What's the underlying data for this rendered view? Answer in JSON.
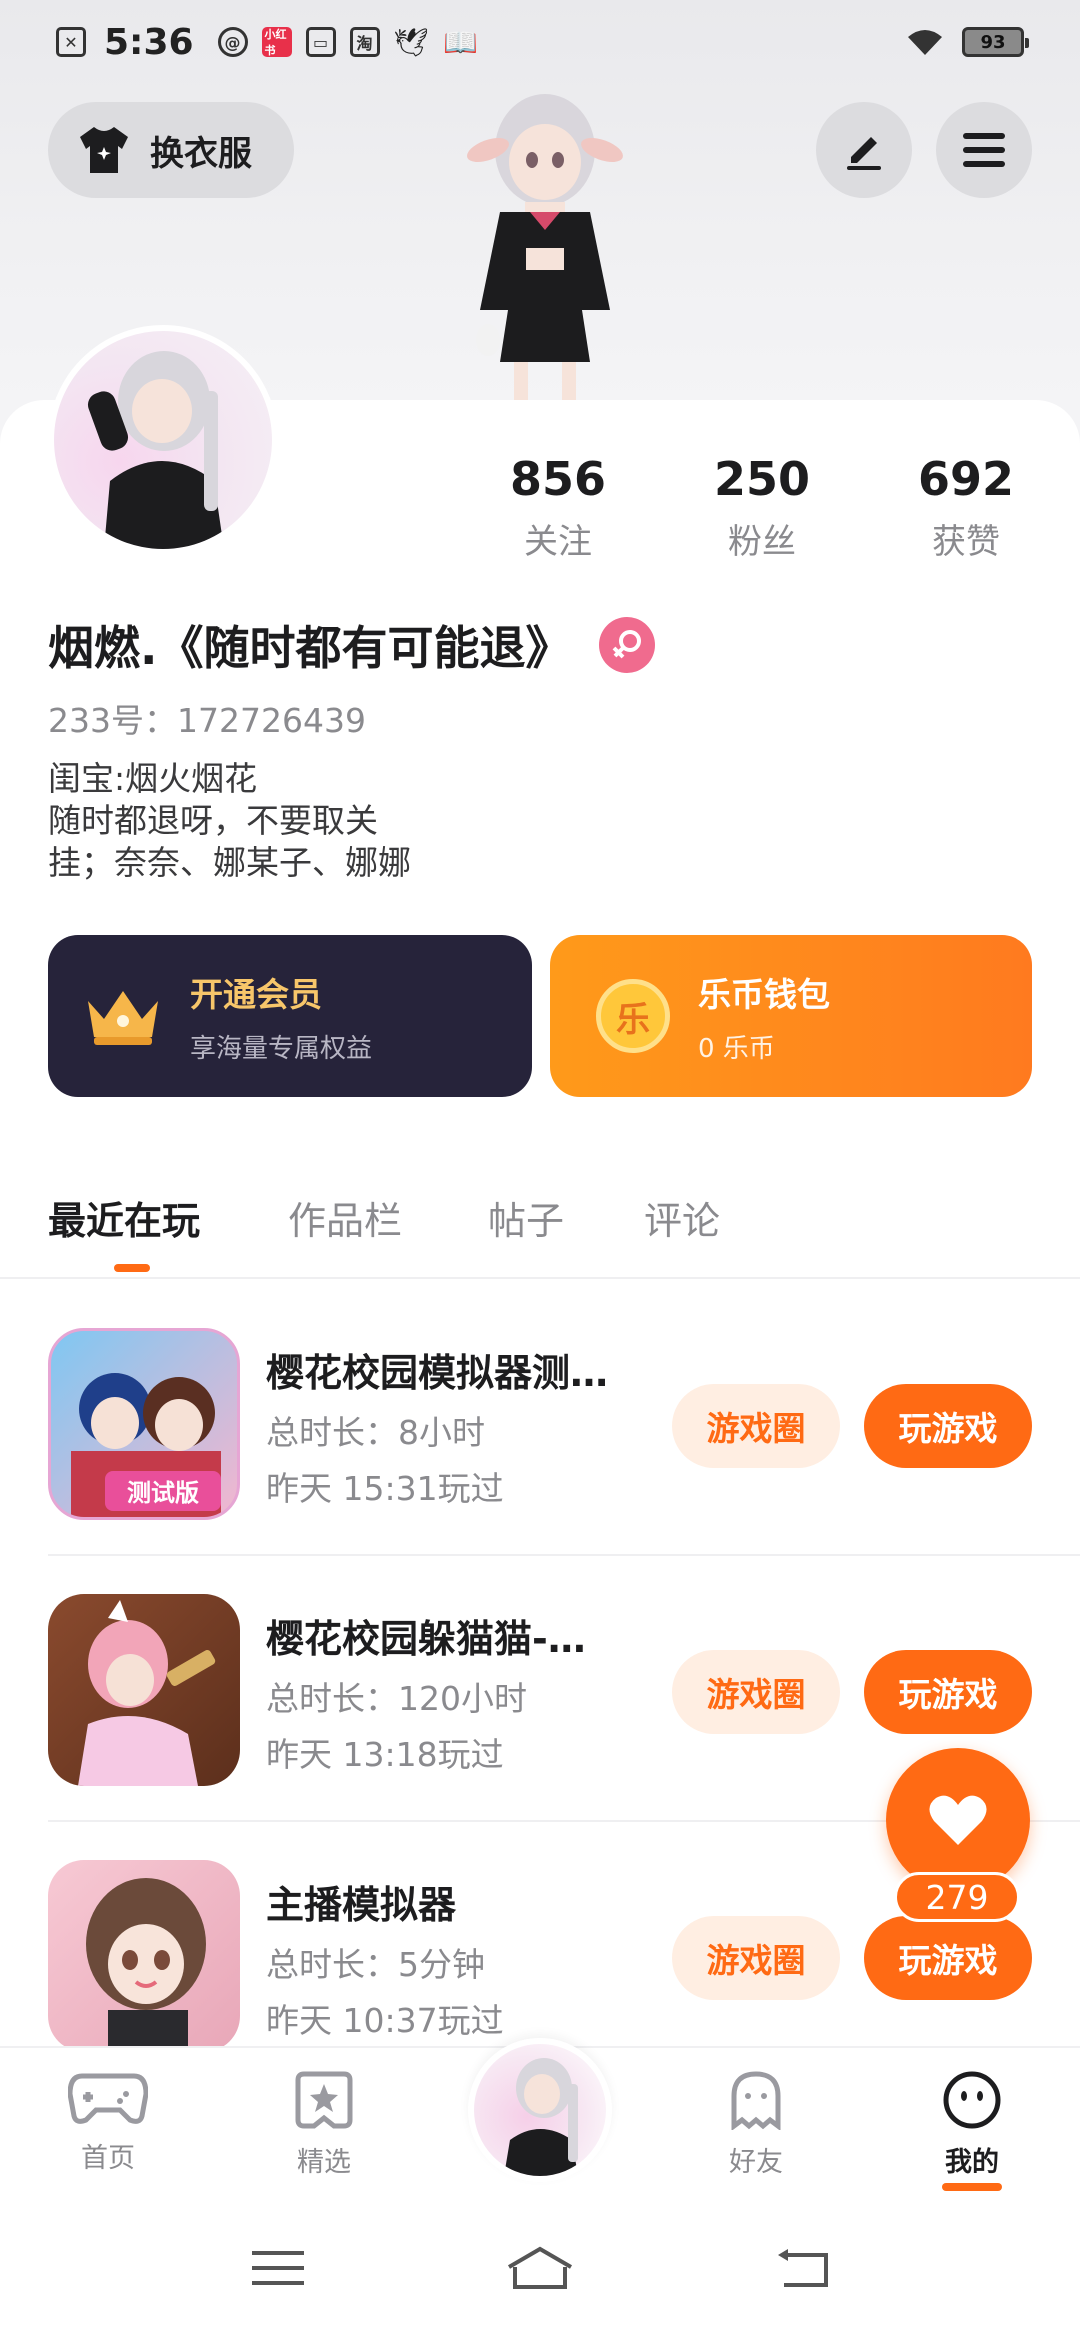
{
  "status_bar": {
    "time": "5:36",
    "icons": [
      "sim-x-icon",
      "chat-icon",
      "xiaohongshu-icon",
      "card-icon",
      "taobao-icon",
      "bird-icon",
      "book-icon"
    ],
    "xiaohongshu_text": "小红书",
    "taobao_text": "淘",
    "battery": "93"
  },
  "header": {
    "wardrobe_label": "换衣服",
    "edit_icon": "pencil-icon",
    "menu_icon": "hamburger-icon"
  },
  "profile": {
    "stats": [
      {
        "value": "856",
        "label": "关注"
      },
      {
        "value": "250",
        "label": "粉丝"
      },
      {
        "value": "692",
        "label": "获赞"
      }
    ],
    "nickname": "烟燃.《随时都有可能退》",
    "gender": "female-icon",
    "user_id": "233号：172726439",
    "bio": [
      "闺宝:烟火烟花",
      "随时都退呀，不要取关",
      "挂；奈奈、娜某子、娜娜"
    ]
  },
  "cards": {
    "vip": {
      "title": "开通会员",
      "subtitle": "享海量专属权益"
    },
    "wallet": {
      "title": "乐币钱包",
      "subtitle": "0 乐币",
      "coin_text": "乐"
    }
  },
  "tabs": [
    {
      "label": "最近在玩",
      "active": true
    },
    {
      "label": "作品栏",
      "active": false
    },
    {
      "label": "帖子",
      "active": false
    },
    {
      "label": "评论",
      "active": false
    }
  ],
  "games": [
    {
      "title": "樱花校园模拟器测…",
      "duration": "总时长：8小时",
      "last_played": "昨天 15:31玩过",
      "badge": "测试版"
    },
    {
      "title": "樱花校园躲猫猫-…",
      "duration": "总时长：120小时",
      "last_played": "昨天 13:18玩过"
    },
    {
      "title": "主播模拟器",
      "duration": "总时长：5分钟",
      "last_played": "昨天 10:37玩过"
    }
  ],
  "game_buttons": {
    "circle": "游戏圈",
    "play": "玩游戏"
  },
  "like": {
    "count": "279"
  },
  "bottom_nav": [
    {
      "label": "首页",
      "icon": "gamepad-icon"
    },
    {
      "label": "精选",
      "icon": "star-bookmark-icon"
    },
    {
      "label": "",
      "icon": "avatar"
    },
    {
      "label": "好友",
      "icon": "ghost-icon"
    },
    {
      "label": "我的",
      "icon": "smiley-icon",
      "active": true
    }
  ],
  "colors": {
    "accent": "#ff6a14",
    "vip_bg": "#26233a",
    "gender_pink": "#f06b8e"
  }
}
